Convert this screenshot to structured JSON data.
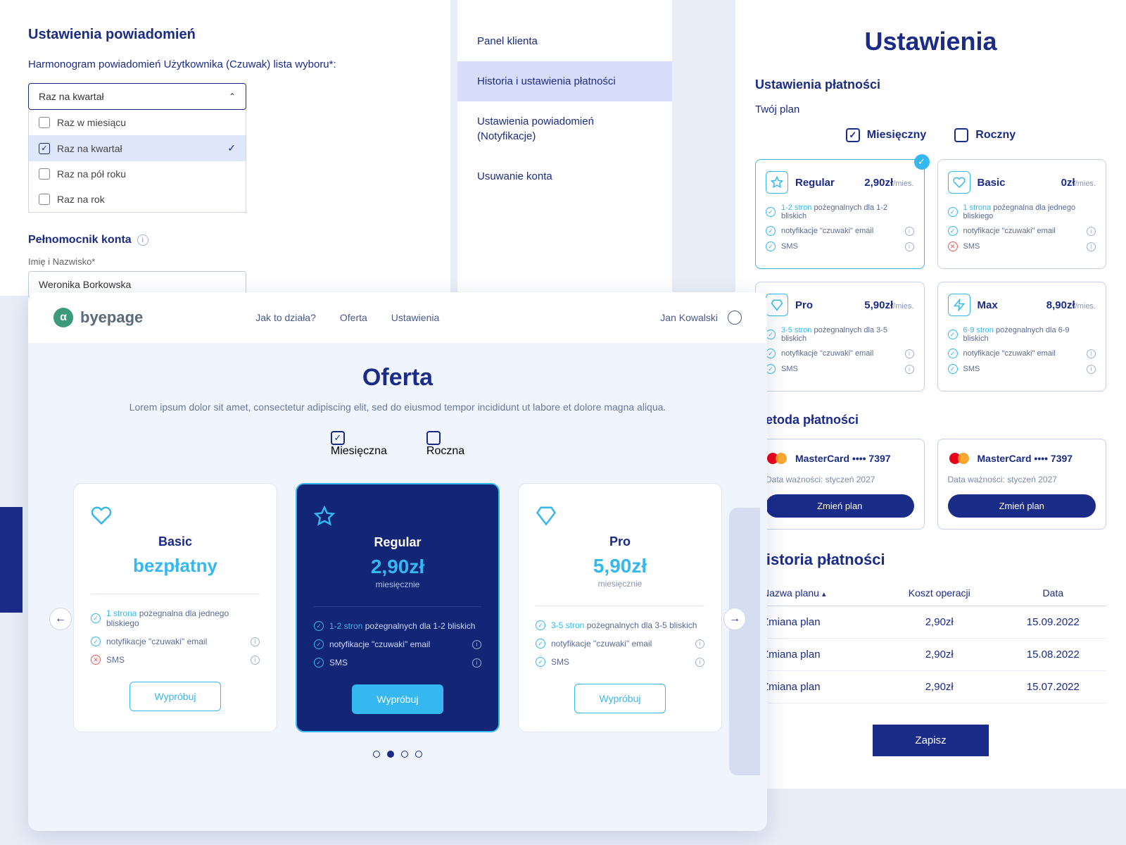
{
  "notif": {
    "title": "Ustawienia powiadomień",
    "schedule_label": "Harmonogram powiadomień Użytkownika (Czuwak) lista wyboru*:",
    "selected": "Raz na kwartał",
    "options": [
      "Raz w miesiącu",
      "Raz na kwartał",
      "Raz na pół roku",
      "Raz na rok"
    ],
    "proxy_heading": "Pełnomocnik konta",
    "name_label": "Imię i Nazwisko*",
    "name_value": "Weronika Borkowska"
  },
  "nav": {
    "items": [
      "Panel klienta",
      "Historia i ustawienia płatności",
      "Ustawienia powiadomień (Notyfikacje)",
      "Usuwanie konta"
    ]
  },
  "settings": {
    "title": "Ustawienia",
    "payments_heading": "Ustawienia płatności",
    "plan_label": "Twój plan",
    "period": {
      "monthly": "Miesięczny",
      "yearly": "Roczny"
    },
    "plans": [
      {
        "name": "Regular",
        "price": "2,90zł",
        "per": "/mies.",
        "feat1_hl": "1-2 stron",
        "feat1_rest": " pożegnalnych dla 1-2 bliskich",
        "feat2": "notyfikacje \"czuwaki\" email",
        "feat3": "SMS"
      },
      {
        "name": "Basic",
        "price": "0zł",
        "per": "/mies.",
        "feat1_hl": "1 strona",
        "feat1_rest": " pożegnalna dla jednego bliskiego",
        "feat2": "notyfikacje \"czuwaki\" email",
        "feat3": "SMS"
      },
      {
        "name": "Pro",
        "price": "5,90zł",
        "per": "/mies.",
        "feat1_hl": "3-5 stron",
        "feat1_rest": " pożegnalnych dla 3-5 bliskich",
        "feat2": "notyfikacje \"czuwaki\" email",
        "feat3": "SMS"
      },
      {
        "name": "Max",
        "price": "8,90zł",
        "per": "/mies.",
        "feat1_hl": "6-9 stron",
        "feat1_rest": " pożegnalnych dla 6-9 bliskich",
        "feat2": "notyfikacje \"czuwaki\" email",
        "feat3": "SMS"
      }
    ],
    "method_heading": "Metoda płatności",
    "card": {
      "name": "MasterCard •••• 7397",
      "expiry": "Data ważności: styczeń 2027",
      "btn": "Zmień plan"
    },
    "history_heading": "Historia płatności",
    "history_cols": [
      "Nazwa planu",
      "Koszt operacji",
      "Data"
    ],
    "history_rows": [
      [
        "Zmiana plan",
        "2,90zł",
        "15.09.2022"
      ],
      [
        "Zmiana plan",
        "2,90zł",
        "15.08.2022"
      ],
      [
        "Zmiana plan",
        "2,90zł",
        "15.07.2022"
      ]
    ],
    "save": "Zapisz"
  },
  "offer": {
    "brand": "byepage",
    "nav": [
      "Jak to działa?",
      "Oferta",
      "Ustawienia"
    ],
    "user": "Jan Kowalski",
    "title": "Oferta",
    "desc": "Lorem ipsum dolor sit amet, consectetur adipiscing elit, sed do eiusmod tempor incididunt ut labore et dolore magna aliqua.",
    "period": {
      "monthly": "Miesięczna",
      "yearly": "Roczna"
    },
    "plans": [
      {
        "name": "Basic",
        "free": "bezpłatny",
        "feat1_hl": "1 strona",
        "feat1_rest": " pożegnalna dla jednego bliskiego",
        "feat2": "notyfikacje \"czuwaki\" email",
        "feat3": "SMS",
        "btn": "Wypróbuj"
      },
      {
        "name": "Regular",
        "price": "2,90zł",
        "per": "miesięcznie",
        "feat1_hl": "1-2 stron",
        "feat1_rest": " pożegnalnych dla 1-2 bliskich",
        "feat2": "notyfikacje \"czuwaki\" email",
        "feat3": "SMS",
        "btn": "Wypróbuj"
      },
      {
        "name": "Pro",
        "price": "5,90zł",
        "per": "miesięcznie",
        "feat1_hl": "3-5 stron",
        "feat1_rest": " pożegnalnych dla 3-5 bliskich",
        "feat2": "notyfikacje \"czuwaki\" email",
        "feat3": "SMS",
        "btn": "Wypróbuj"
      }
    ]
  }
}
